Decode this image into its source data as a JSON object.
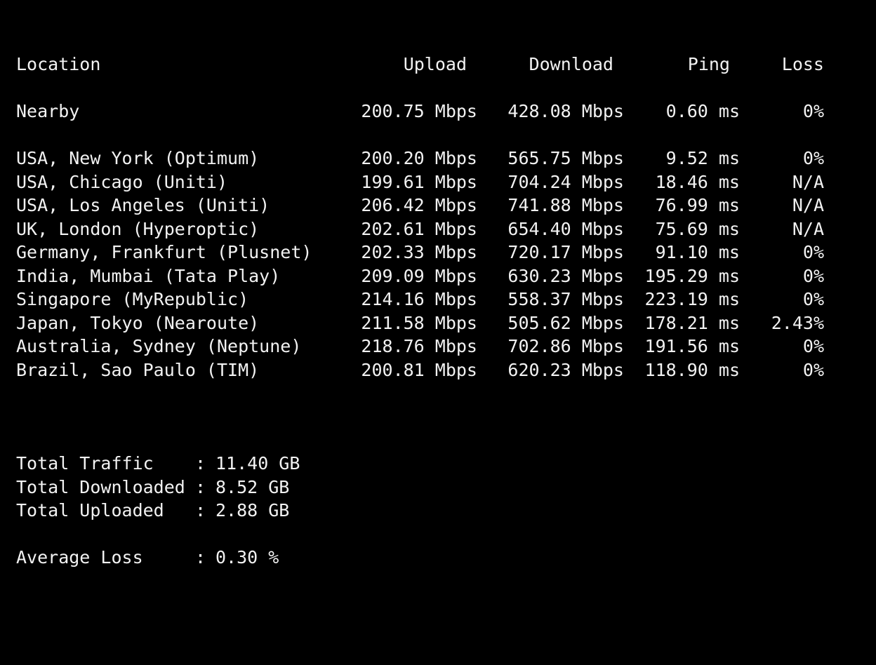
{
  "header": {
    "location": "Location",
    "upload": "Upload",
    "download": "Download",
    "ping": "Ping",
    "loss": "Loss"
  },
  "rows": [
    {
      "location": "Nearby",
      "upload": "200.75 Mbps",
      "download": "428.08 Mbps",
      "ping": "0.60 ms",
      "loss": "0%"
    },
    {
      "location": "USA, New York (Optimum)",
      "upload": "200.20 Mbps",
      "download": "565.75 Mbps",
      "ping": "9.52 ms",
      "loss": "0%"
    },
    {
      "location": "USA, Chicago (Uniti)",
      "upload": "199.61 Mbps",
      "download": "704.24 Mbps",
      "ping": "18.46 ms",
      "loss": "N/A"
    },
    {
      "location": "USA, Los Angeles (Uniti)",
      "upload": "206.42 Mbps",
      "download": "741.88 Mbps",
      "ping": "76.99 ms",
      "loss": "N/A"
    },
    {
      "location": "UK, London (Hyperoptic)",
      "upload": "202.61 Mbps",
      "download": "654.40 Mbps",
      "ping": "75.69 ms",
      "loss": "N/A"
    },
    {
      "location": "Germany, Frankfurt (Plusnet)",
      "upload": "202.33 Mbps",
      "download": "720.17 Mbps",
      "ping": "91.10 ms",
      "loss": "0%"
    },
    {
      "location": "India, Mumbai (Tata Play)",
      "upload": "209.09 Mbps",
      "download": "630.23 Mbps",
      "ping": "195.29 ms",
      "loss": "0%"
    },
    {
      "location": "Singapore (MyRepublic)",
      "upload": "214.16 Mbps",
      "download": "558.37 Mbps",
      "ping": "223.19 ms",
      "loss": "0%"
    },
    {
      "location": "Japan, Tokyo (Nearoute)",
      "upload": "211.58 Mbps",
      "download": "505.62 Mbps",
      "ping": "178.21 ms",
      "loss": "2.43%"
    },
    {
      "location": "Australia, Sydney (Neptune)",
      "upload": "218.76 Mbps",
      "download": "702.86 Mbps",
      "ping": "191.56 ms",
      "loss": "0%"
    },
    {
      "location": "Brazil, Sao Paulo (TIM)",
      "upload": "200.81 Mbps",
      "download": "620.23 Mbps",
      "ping": "118.90 ms",
      "loss": "0%"
    }
  ],
  "summary": [
    {
      "label": "Total Traffic",
      "value": "11.40 GB"
    },
    {
      "label": "Total Downloaded",
      "value": "8.52 GB"
    },
    {
      "label": "Total Uploaded",
      "value": "2.88 GB"
    },
    {
      "label": "Average Loss",
      "value": "0.30 %"
    }
  ],
  "separator": ":",
  "colors": {
    "background": "#000000",
    "text": "#f2f2f2"
  }
}
